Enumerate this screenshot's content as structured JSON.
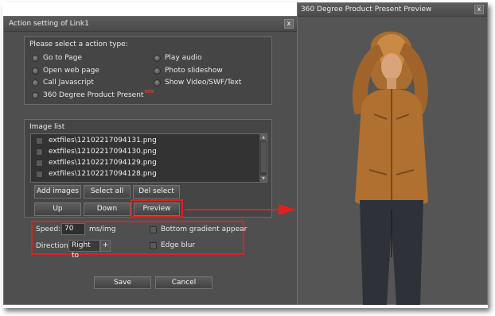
{
  "dialog": {
    "title": "Action setting of Link1",
    "close_label": "x"
  },
  "action_type": {
    "title": "Please select a action type:",
    "options": [
      "Go to Page",
      "Open web page",
      "Call Javascript",
      "360 Degree Product Present",
      "Play audio",
      "Photo slideshow",
      "Show Video/SWF/Text"
    ],
    "new_badge": "NEW",
    "selected": "360 Degree Product Present"
  },
  "image_list": {
    "title": "Image list",
    "items": [
      "extfiles\\12102217094131.png",
      "extfiles\\12102217094130.png",
      "extfiles\\12102217094129.png",
      "extfiles\\12102217094128.png"
    ],
    "buttons": {
      "add_images": "Add images",
      "select_all": "Select all",
      "del_select": "Del select",
      "up": "Up",
      "down": "Down",
      "preview": "Preview"
    }
  },
  "settings": {
    "speed_label": "Speed:",
    "speed_value": "70",
    "speed_unit": "ms/img",
    "direction_label": "Direction:",
    "direction_value": "Right to",
    "direction_plus": "+",
    "bottom_gradient_label": "Bottom gradient appear",
    "edge_blur_label": "Edge blur"
  },
  "footer": {
    "save_label": "Save",
    "cancel_label": "Cancel"
  },
  "preview_window": {
    "title": "360 Degree Product Present Preview",
    "close_label": "x"
  },
  "colors": {
    "highlight_red": "#e02020",
    "dialog_bg": "#4f4f4f",
    "preview_bg": "#555555",
    "new_badge": "#ff3b3b"
  }
}
